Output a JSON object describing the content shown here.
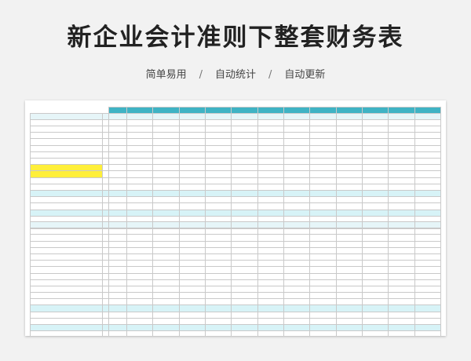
{
  "title": "新企业会计准则下整套财务表",
  "tags": [
    "简单易用",
    "自动统计",
    "自动更新"
  ],
  "divider": "/"
}
